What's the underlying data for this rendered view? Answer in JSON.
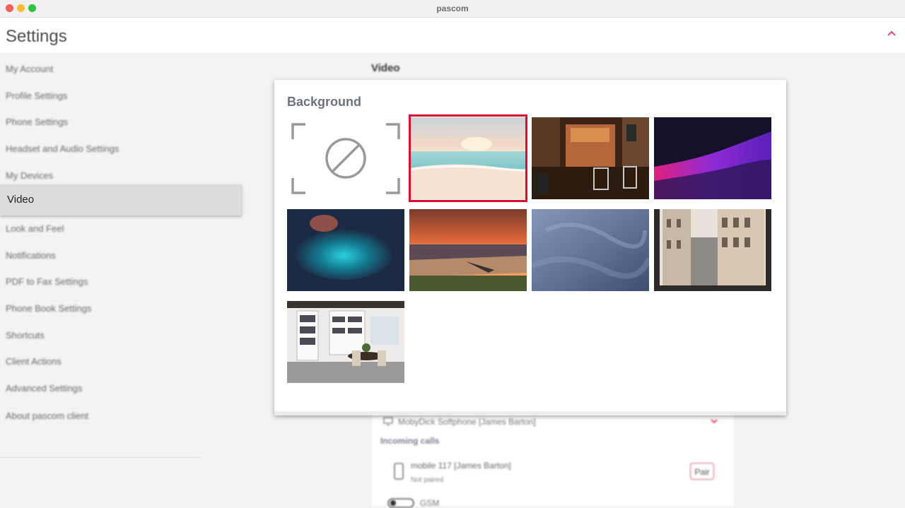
{
  "window": {
    "title": "pascom"
  },
  "header": {
    "title": "Settings"
  },
  "sidebar": {
    "items": [
      {
        "label": "My Account"
      },
      {
        "label": "Profile Settings"
      },
      {
        "label": "Phone Settings"
      },
      {
        "label": "Headset and Audio Settings"
      },
      {
        "label": "My Devices"
      },
      {
        "label": "Video"
      },
      {
        "label": "Look and Feel"
      },
      {
        "label": "Notifications"
      },
      {
        "label": "PDF to Fax Settings"
      },
      {
        "label": "Phone Book Settings"
      },
      {
        "label": "Shortcuts"
      },
      {
        "label": "Client Actions"
      },
      {
        "label": "Advanced Settings"
      },
      {
        "label": "About pascom client"
      }
    ],
    "selected": "Video"
  },
  "main": {
    "section_title": "Video",
    "devices": {
      "softphone": "MobyDick Softphone [James Barton]",
      "incoming_label": "Incoming calls",
      "mobile_name": "mobile 117 [James Barton]",
      "mobile_status": "Not paired",
      "pair_label": "Pair",
      "gsm_label": "GSM"
    }
  },
  "modal": {
    "title": "Background",
    "options": [
      {
        "name": "none",
        "icon": "no-background-icon"
      },
      {
        "name": "beach",
        "selected": true
      },
      {
        "name": "cafe"
      },
      {
        "name": "purple-wave"
      },
      {
        "name": "blue-aurora"
      },
      {
        "name": "sunset-beach"
      },
      {
        "name": "blue-texture"
      },
      {
        "name": "city-street"
      },
      {
        "name": "office-library"
      }
    ]
  },
  "colors": {
    "accent": "#d8102e",
    "selected_item_bg": "#dcdcdc"
  }
}
